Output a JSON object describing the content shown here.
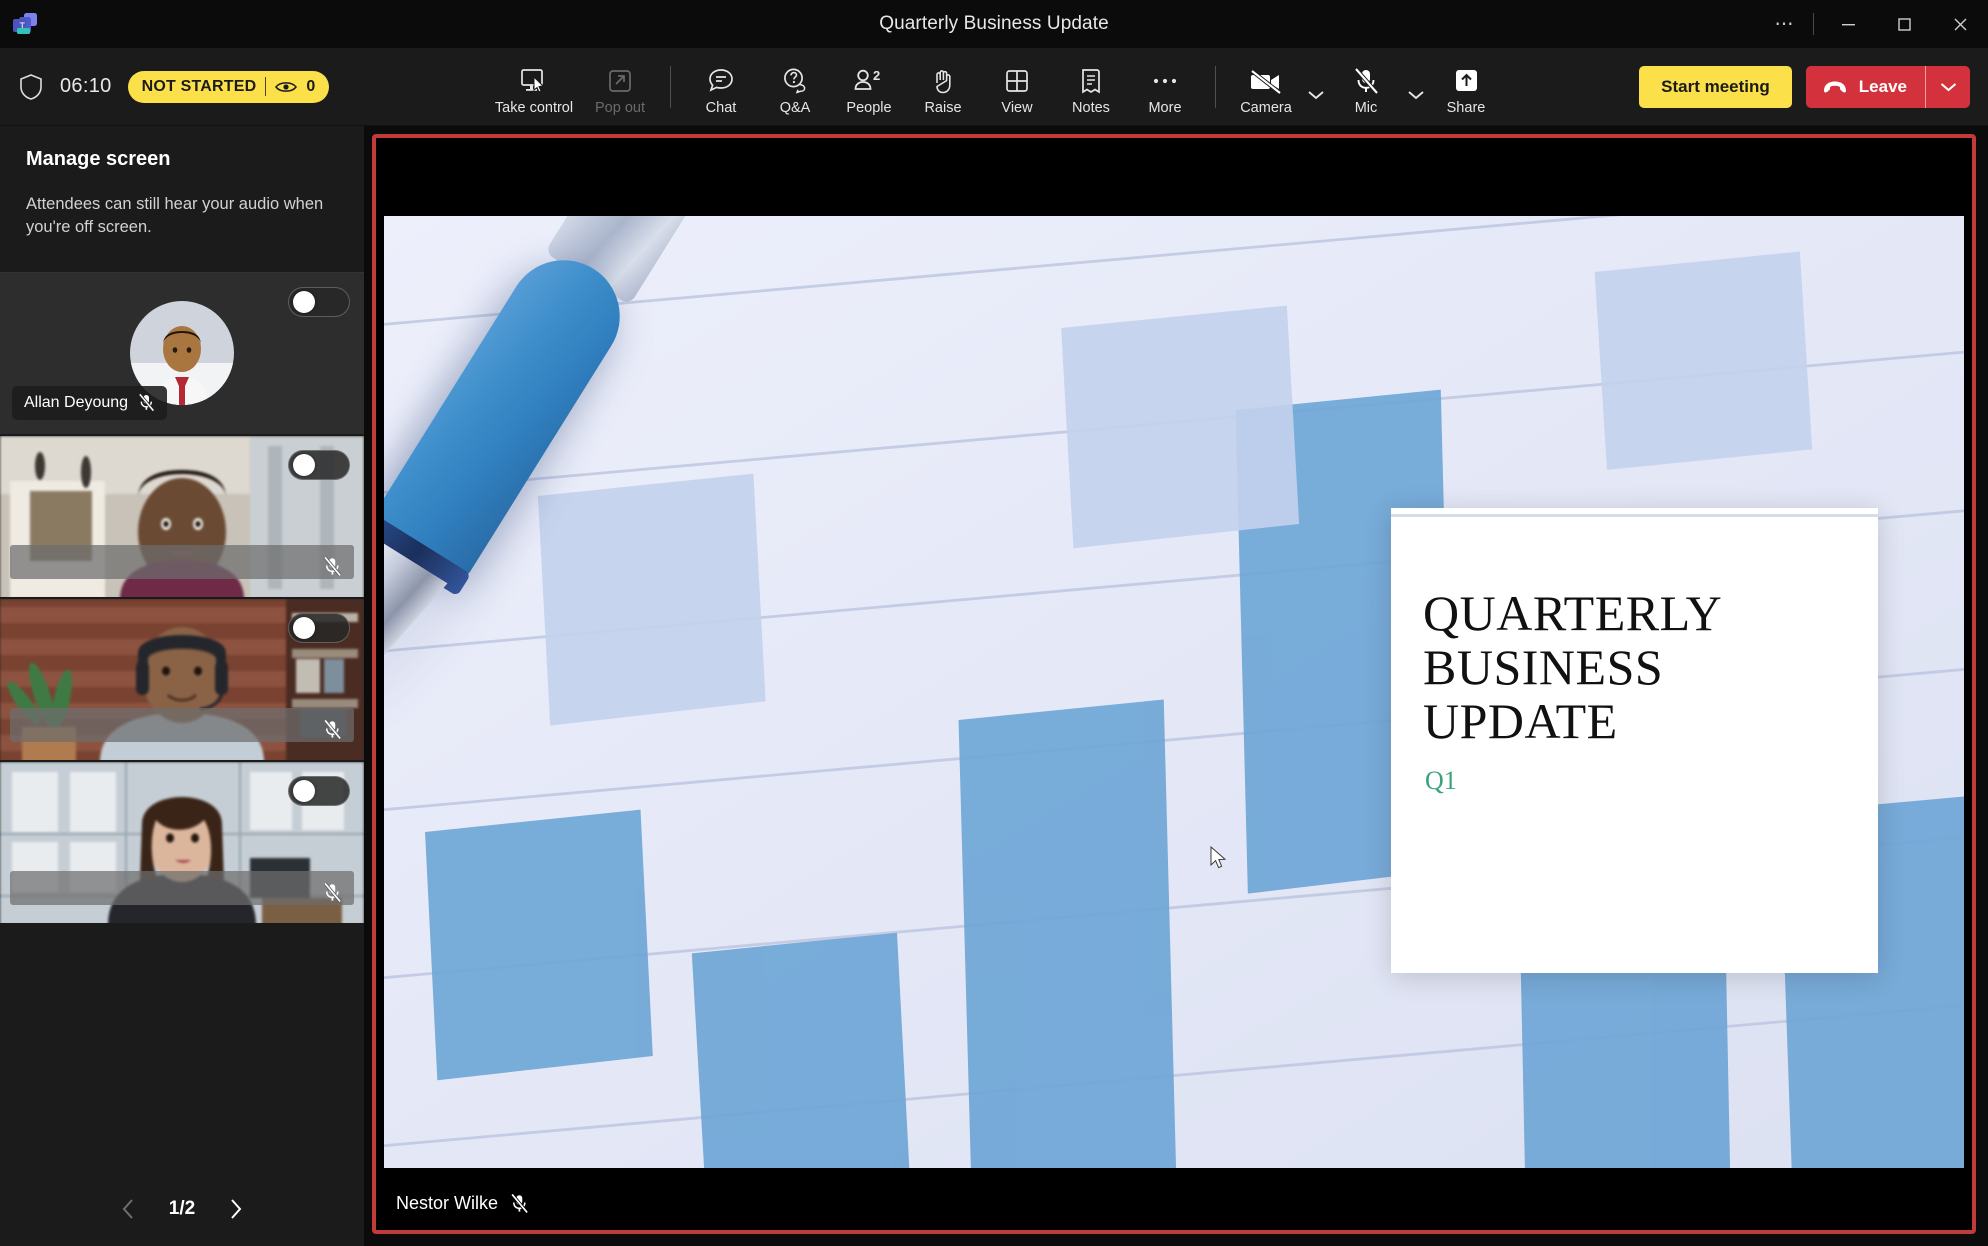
{
  "window": {
    "title": "Quarterly Business Update",
    "logo_icon": "teams-logo-icon",
    "more_icon": "overflow-menu-icon",
    "minimize_icon": "minimize-icon",
    "maximize_icon": "maximize-icon",
    "close_icon": "close-icon"
  },
  "toolbar": {
    "shield_icon": "shield-icon",
    "timer": "06:10",
    "badge": {
      "status": "NOT STARTED",
      "viewers_icon": "eye-icon",
      "viewers_count": "0"
    },
    "tools": [
      {
        "id": "take-control",
        "label": "Take control",
        "icon": "screen-cursor-icon",
        "disabled": false
      },
      {
        "id": "pop-out",
        "label": "Pop out",
        "icon": "pop-out-icon",
        "disabled": true
      },
      {
        "id": "chat",
        "label": "Chat",
        "icon": "chat-icon",
        "disabled": false
      },
      {
        "id": "qa",
        "label": "Q&A",
        "icon": "qa-icon",
        "disabled": false
      },
      {
        "id": "people",
        "label": "People",
        "icon": "people-icon",
        "disabled": false,
        "count": "2"
      },
      {
        "id": "raise",
        "label": "Raise",
        "icon": "raise-hand-icon",
        "disabled": false
      },
      {
        "id": "view",
        "label": "View",
        "icon": "grid-view-icon",
        "disabled": false
      },
      {
        "id": "notes",
        "label": "Notes",
        "icon": "notes-icon",
        "disabled": false
      },
      {
        "id": "more",
        "label": "More",
        "icon": "more-dots-icon",
        "disabled": false
      }
    ],
    "media": [
      {
        "id": "camera",
        "label": "Camera",
        "icon": "camera-off-icon",
        "state": "off"
      },
      {
        "id": "mic",
        "label": "Mic",
        "icon": "mic-off-icon",
        "state": "off"
      },
      {
        "id": "share",
        "label": "Share",
        "icon": "share-screen-icon",
        "state": "active"
      }
    ],
    "start_meeting_label": "Start meeting",
    "leave_label": "Leave",
    "leave_icon": "hangup-icon",
    "leave_chevron_icon": "chevron-down-icon"
  },
  "sidebar": {
    "title": "Manage screen",
    "description": "Attendees can still hear your audio when you're off screen.",
    "tiles": [
      {
        "name": "Allan Deyoung",
        "redacted": false,
        "muted": true,
        "toggle": "off",
        "mic_icon": "mic-muted-icon"
      },
      {
        "name": "",
        "redacted": true,
        "muted": true,
        "toggle": "off",
        "mic_icon": "mic-muted-icon"
      },
      {
        "name": "",
        "redacted": true,
        "muted": true,
        "toggle": "off",
        "mic_icon": "mic-muted-icon"
      },
      {
        "name": "",
        "redacted": true,
        "muted": true,
        "toggle": "off",
        "mic_icon": "mic-muted-icon"
      }
    ],
    "pager": {
      "prev_icon": "chevron-left-icon",
      "next_icon": "chevron-right-icon",
      "page_label": "1/2"
    }
  },
  "stage": {
    "presenter_name": "Nestor Wilke",
    "presenter_mic_icon": "mic-muted-icon",
    "border_color": "#c33a3a",
    "slide": {
      "title_line1": "QUARTERLY",
      "title_line2": "BUSINESS",
      "title_line3": "UPDATE",
      "subtitle": "Q1",
      "subtitle_color": "#3aa37a"
    }
  },
  "colors": {
    "accent_yellow": "#fbe04a",
    "leave_red": "#d3323c",
    "share_border_red": "#c33a3a",
    "panel_bg": "#1b1b1b",
    "titlebar_bg": "#0b0b0b"
  }
}
